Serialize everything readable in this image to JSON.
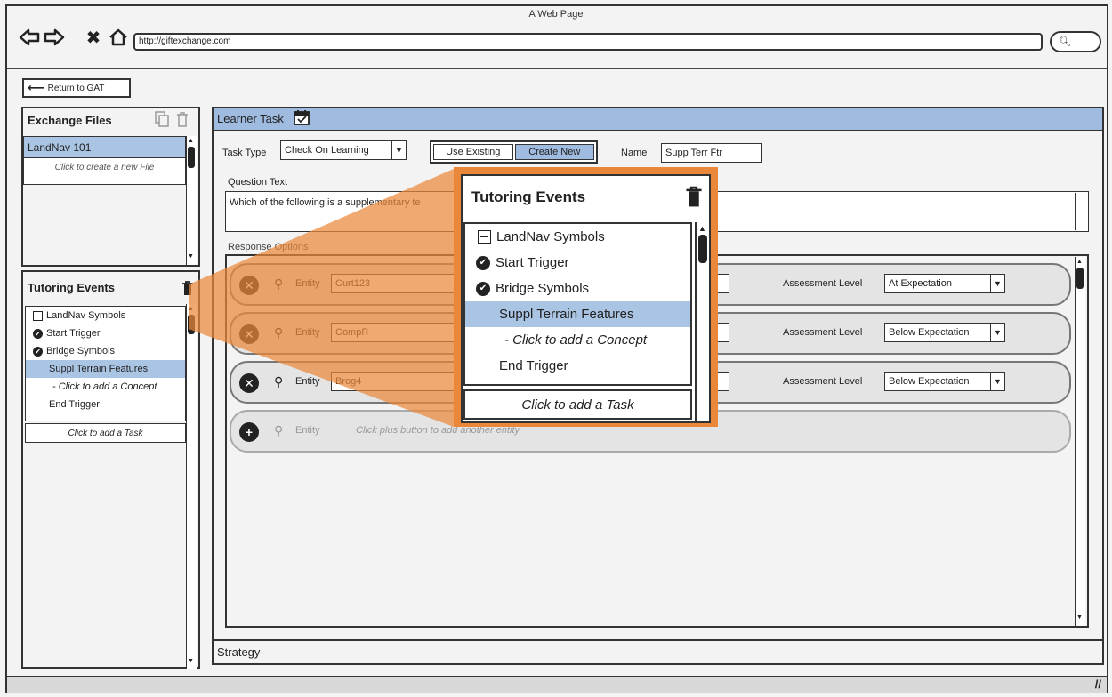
{
  "window": {
    "title": "A Web Page",
    "url": "http://giftexchange.com"
  },
  "return_label": "Return to GAT",
  "exchange_files": {
    "title": "Exchange Files",
    "items": [
      "LandNav 101"
    ],
    "create_hint": "Click to create a new File"
  },
  "tutoring_events": {
    "title": "Tutoring Events",
    "items": [
      {
        "label": "LandNav Symbols",
        "icon": "minus-box-icon"
      },
      {
        "label": "Start Trigger",
        "icon": "check-circle-icon"
      },
      {
        "label": "Bridge Symbols",
        "icon": "check-circle-icon"
      },
      {
        "label": "Suppl Terrain Features",
        "selected": true
      },
      {
        "label": "- Click to add a Concept",
        "italic": true
      },
      {
        "label": "End Trigger"
      }
    ],
    "add_task": "Click to add a Task"
  },
  "learner_task": {
    "title": "Learner Task",
    "task_type_label": "Task Type",
    "task_type_value": "Check On Learning",
    "use_existing": "Use Existing",
    "create_new": "Create New",
    "name_label": "Name",
    "name_value": "Supp Terr Ftr",
    "question_label": "Question Text",
    "question_value": "Which of the following is a supplementary te",
    "response_label": "Response Options",
    "entity_label": "Entity",
    "assessment_label": "Assessment Level",
    "responses": [
      {
        "entity": "Curt123",
        "level": "At Expectation"
      },
      {
        "entity": "CompR",
        "level": "Below Expectation"
      },
      {
        "entity": "Brog4",
        "level": "Below Expectation"
      }
    ],
    "add_entity_hint": "Click plus button to add another entity",
    "strategy_label": "Strategy"
  },
  "colors": {
    "accent": "#e9883a",
    "selection": "#aac4e4",
    "header": "#9fbbdf"
  }
}
